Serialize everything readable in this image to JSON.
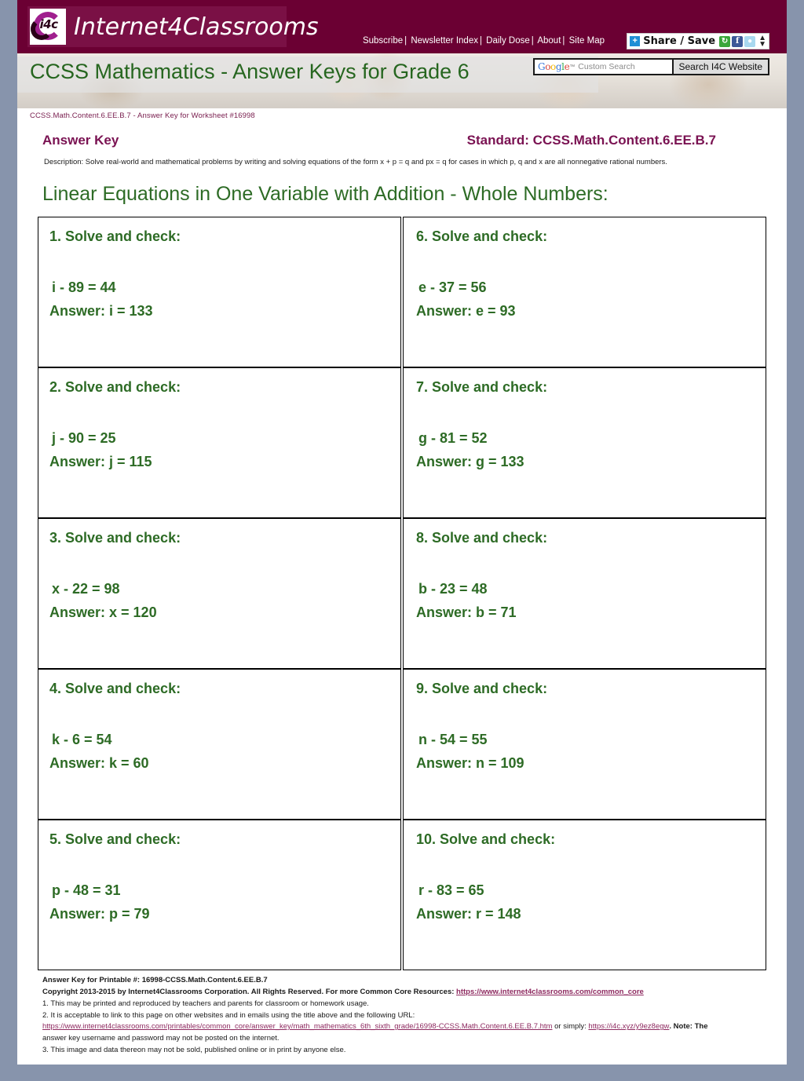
{
  "site": {
    "logo_text": "Internet4Classrooms",
    "logo_badge": "i4c",
    "nav": [
      {
        "label": "Subscribe"
      },
      {
        "label": "Newsletter Index"
      },
      {
        "label": "Daily Dose"
      },
      {
        "label": "About"
      },
      {
        "label": "Site Map"
      }
    ],
    "share": {
      "plus": "+",
      "label": "Share / Save",
      "icons": [
        "share-icon",
        "facebook-icon",
        "twitter-icon"
      ],
      "arrows": "↕"
    },
    "search": {
      "brand_g": "G",
      "brand_o1": "o",
      "brand_o2": "o",
      "brand_g2": "g",
      "brand_l": "l",
      "brand_e": "e",
      "trademark": "™",
      "placeholder": "Custom Search",
      "value": "",
      "button_label": "Search I4C Website"
    }
  },
  "banner": {
    "title": "CCSS Mathematics - Answer Keys for Grade 6"
  },
  "header": {
    "worksheet_ref": "CCSS.Math.Content.6.EE.B.7 - Answer Key for Worksheet #16998",
    "answer_key_label": "Answer Key",
    "standard_label": "Standard: CCSS.Math.Content.6.EE.B.7",
    "description": "Description: Solve real-world and mathematical problems by writing and solving equations of the form x + p = q and px = q for cases in which p, q and x are all nonnegative rational numbers.",
    "sheet_title": "Linear Equations in One Variable with Addition - Whole Numbers:"
  },
  "problems": [
    {
      "head": "1. Solve and check:",
      "equation": "i - 89 = 44",
      "answer": "Answer: i = 133"
    },
    {
      "head": "2. Solve and check:",
      "equation": "j - 90 = 25",
      "answer": "Answer: j = 115"
    },
    {
      "head": "3. Solve and check:",
      "equation": "x - 22 = 98",
      "answer": "Answer: x = 120"
    },
    {
      "head": "4. Solve and check:",
      "equation": "k - 6 = 54",
      "answer": "Answer: k = 60"
    },
    {
      "head": "5. Solve and check:",
      "equation": "p - 48 = 31",
      "answer": "Answer: p = 79"
    },
    {
      "head": "6. Solve and check:",
      "equation": "e - 37 = 56",
      "answer": "Answer: e = 93"
    },
    {
      "head": "7. Solve and check:",
      "equation": "g - 81 = 52",
      "answer": "Answer: g = 133"
    },
    {
      "head": "8. Solve and check:",
      "equation": "b - 23 = 48",
      "answer": "Answer: b = 71"
    },
    {
      "head": "9. Solve and check:",
      "equation": "n - 54 = 55",
      "answer": "Answer: n = 109"
    },
    {
      "head": "10. Solve and check:",
      "equation": "r - 83 = 65",
      "answer": "Answer: r = 148"
    }
  ],
  "footer": {
    "printable": "Answer Key for Printable #: 16998-CCSS.Math.Content.6.EE.B.7",
    "copyright_pre": "Copyright 2013-2015 by Internet4Classrooms Corporation. All Rights Reserved. For more Common Core Resources: ",
    "copyright_link": "https://www.internet4classrooms.com/common_core",
    "note1": "1. This may be printed and reproduced by teachers and parents for classroom or homework usage.",
    "note2": "2. It is acceptable to link to this page on other websites and in emails using the title above and the following URL:",
    "url_long": "https://www.internet4classrooms.com/printables/common_core/answer_key/math_mathematics_6th_sixth_grade/16998-CCSS.Math.Content.6.EE.B.7.htm",
    "url_mid": " or simply: ",
    "url_short": "https://i4c.xyz/y9ez8egw",
    "url_note": ". Note: The",
    "note2b": "answer key username and password may not be posted on the internet.",
    "note3": "3. This image and data thereon may not be sold, published online or in print by anyone else."
  },
  "colors": {
    "maroon": "#6b0033",
    "green": "#2d6b25",
    "purple": "#7a1252",
    "link": "#8e2a60",
    "page_bg": "#8794ac"
  }
}
